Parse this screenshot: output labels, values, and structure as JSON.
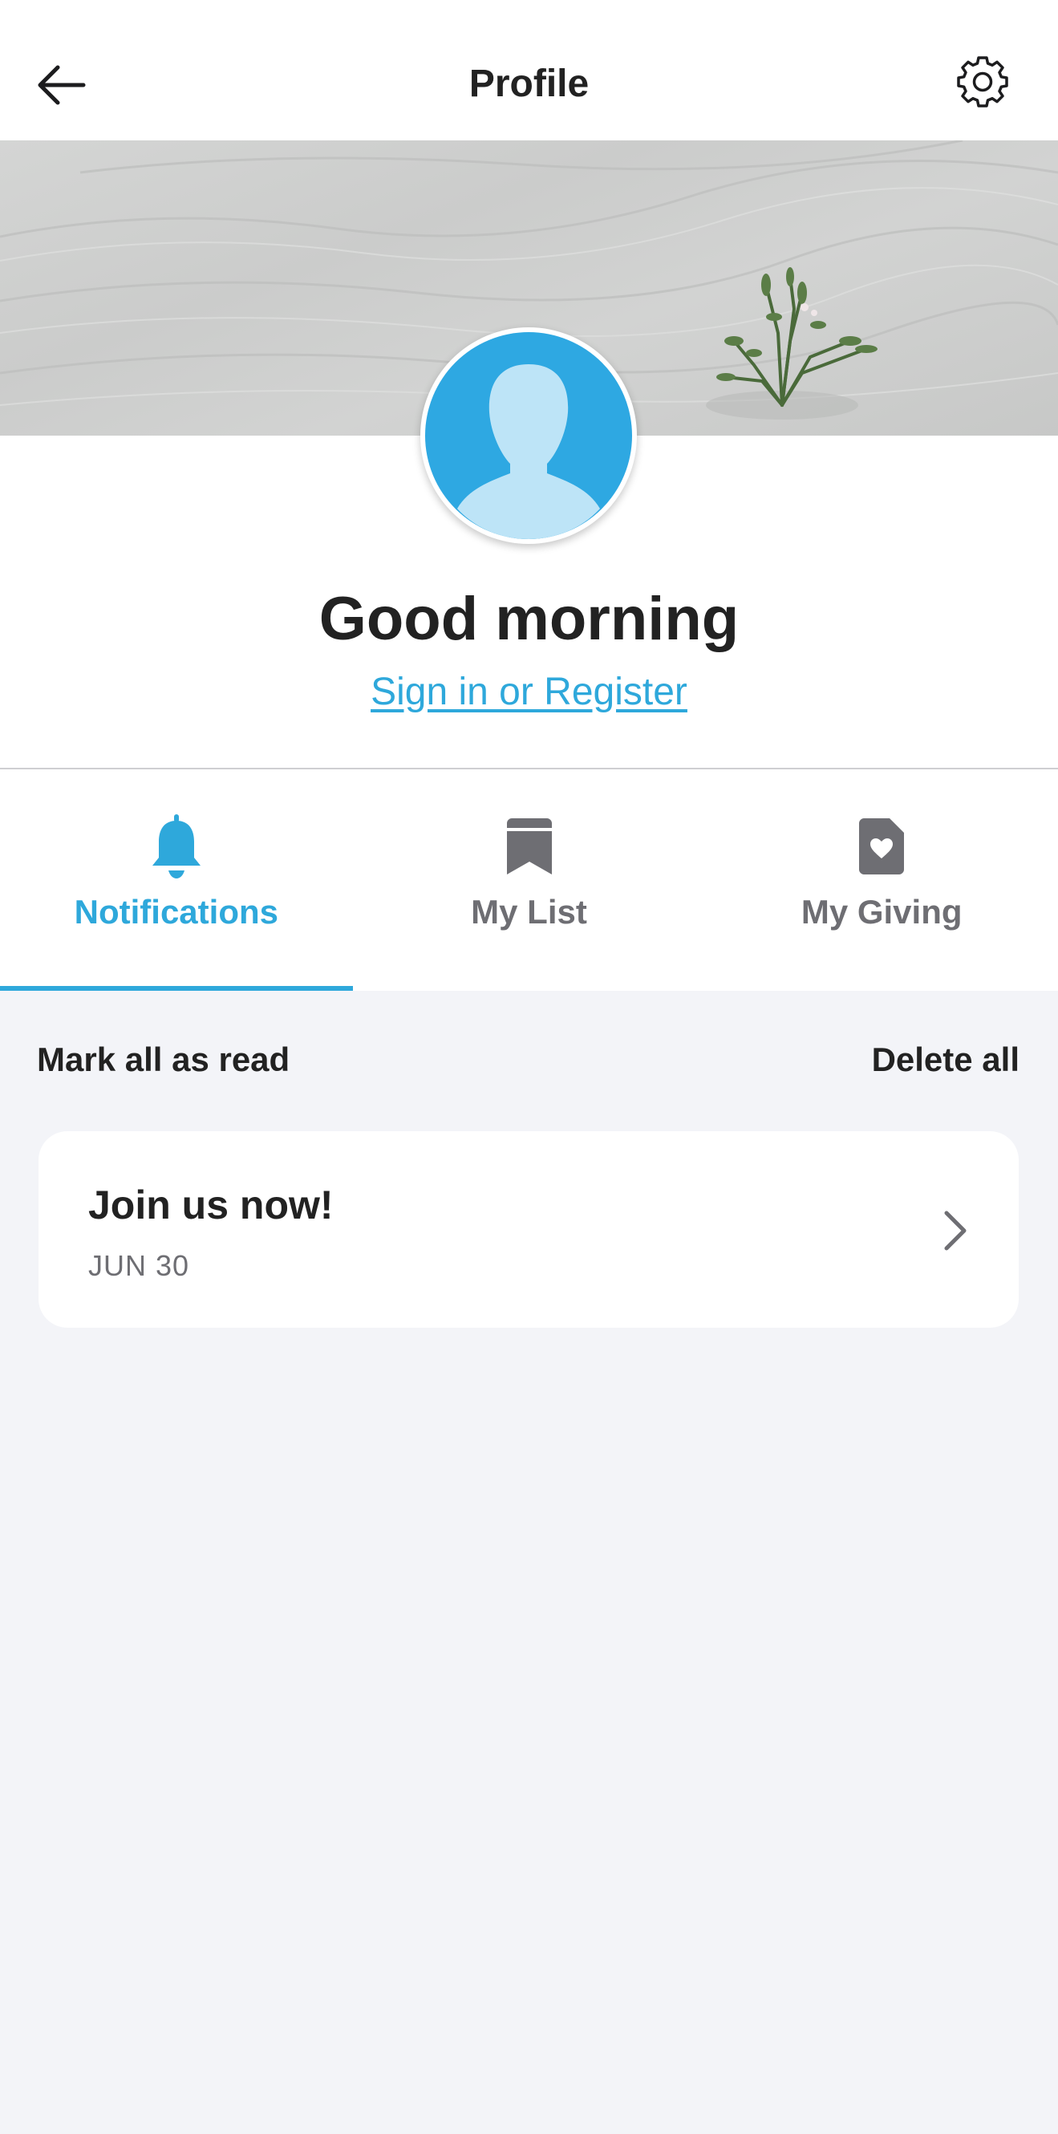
{
  "header": {
    "title": "Profile",
    "back_icon": "arrow-left-icon",
    "settings_icon": "gear-icon"
  },
  "profile": {
    "greeting": "Good morning",
    "signin_label": "Sign in or Register",
    "avatar_icon": "user-silhouette-icon"
  },
  "tabs": [
    {
      "label": "Notifications",
      "icon": "bell-icon",
      "active": true
    },
    {
      "label": "My List",
      "icon": "bookmark-icon",
      "active": false
    },
    {
      "label": "My Giving",
      "icon": "heart-document-icon",
      "active": false
    }
  ],
  "actions": {
    "mark_all_read": "Mark all as read",
    "delete_all": "Delete all"
  },
  "notifications": [
    {
      "title": "Join us now!",
      "date": "JUN 30"
    }
  ],
  "colors": {
    "accent": "#2ea8db",
    "avatar_bg": "#2ea8e2",
    "background": "#f3f4f8",
    "text": "#222222",
    "muted": "#6e6e73"
  }
}
